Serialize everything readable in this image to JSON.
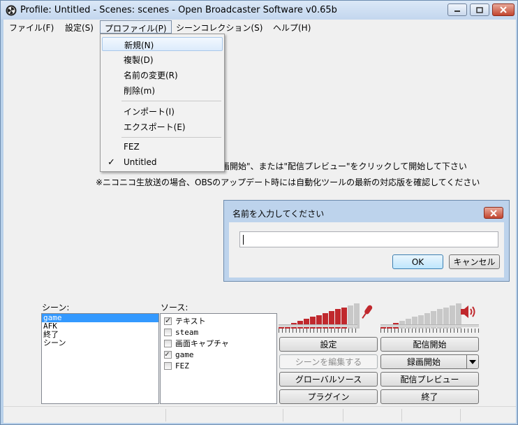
{
  "window": {
    "title": "Profile: Untitled - Scenes: scenes - Open Broadcaster Software v0.65b"
  },
  "menubar": {
    "items": [
      "ファイル(F)",
      "設定(S)",
      "プロファイル(P)",
      "シーンコレクション(S)",
      "ヘルプ(H)"
    ]
  },
  "profile_menu": {
    "items": [
      "新規(N)",
      "複製(D)",
      "名前の変更(R)",
      "削除(m)",
      "インポート(I)",
      "エクスポート(E)",
      "FEZ",
      "Untitled"
    ],
    "checked": "Untitled",
    "check_glyph": "✓"
  },
  "info": {
    "line1": "画開始\"、または\"配信プレビュー\"をクリックして開始して下さい",
    "line2": "※ニコニコ生放送の場合、OBSのアップデート時には自動化ツールの最新の対応版を確認してください"
  },
  "dialog": {
    "title": "名前を入力してください",
    "input_value": "",
    "ok_label": "OK",
    "cancel_label": "キャンセル"
  },
  "scenes": {
    "label": "シーン:",
    "items": [
      "game",
      "AFK",
      "終了",
      "シーン"
    ],
    "selected": "game"
  },
  "sources": {
    "label": "ソース:",
    "items": [
      {
        "name": "テキスト",
        "checked": true
      },
      {
        "name": "steam",
        "checked": false
      },
      {
        "name": "画面キャプチャ",
        "checked": false
      },
      {
        "name": "game",
        "checked": true
      },
      {
        "name": "FEZ",
        "checked": false
      }
    ]
  },
  "meters": {
    "mic_level": 0.82,
    "desktop_level": 0.2,
    "mic_icon": "microphone-icon",
    "speaker_icon": "speaker-icon",
    "accent_red": "#c0282d"
  },
  "buttons": {
    "settings": "設定",
    "start_stream": "配信開始",
    "edit_scene": "シーンを編集する",
    "start_recording": "録画開始",
    "global_sources": "グローバルソース",
    "preview_stream": "配信プレビュー",
    "plugins": "プラグイン",
    "exit": "終了"
  }
}
